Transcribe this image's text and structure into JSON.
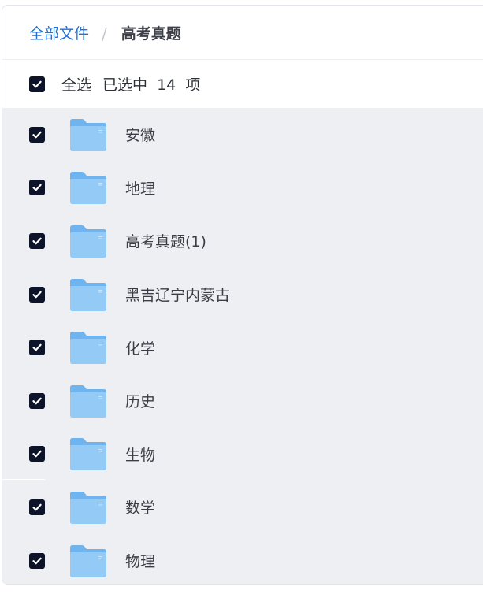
{
  "breadcrumb": {
    "root": "全部文件",
    "separator": "/",
    "current": "高考真题"
  },
  "selection": {
    "select_all_label": "全选",
    "selected_text": "已选中  14  项",
    "all_checked": true
  },
  "folders": [
    {
      "name": "安徽",
      "checked": true,
      "icon": "folder-icon"
    },
    {
      "name": "地理",
      "checked": true,
      "icon": "folder-icon"
    },
    {
      "name": "高考真题(1)",
      "checked": true,
      "icon": "folder-icon"
    },
    {
      "name": "黑吉辽宁内蒙古",
      "checked": true,
      "icon": "folder-icon"
    },
    {
      "name": "化学",
      "checked": true,
      "icon": "folder-icon"
    },
    {
      "name": "历史",
      "checked": true,
      "icon": "folder-icon"
    },
    {
      "name": "生物",
      "checked": true,
      "icon": "folder-icon"
    },
    {
      "name": "数学",
      "checked": true,
      "icon": "folder-icon"
    },
    {
      "name": "物理",
      "checked": true,
      "icon": "folder-icon"
    }
  ],
  "colors": {
    "link": "#1f6fd6",
    "checkbox": "#0d1328",
    "list_background": "#eeeff3",
    "folder_back": "#6fb4ef",
    "folder_front": "#8fc8f6"
  }
}
